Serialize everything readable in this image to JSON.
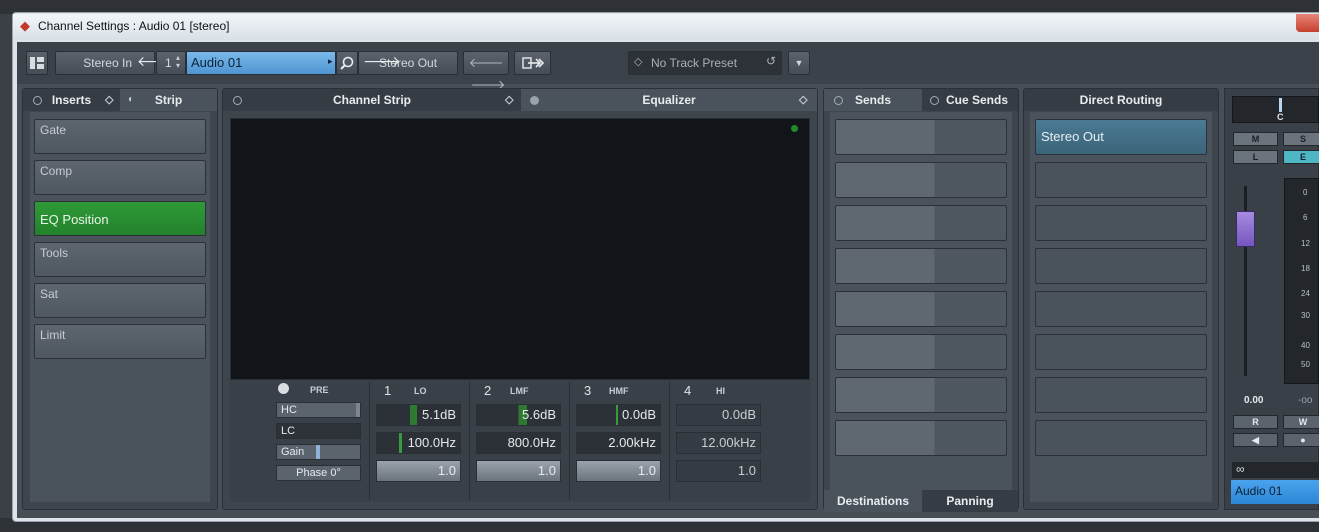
{
  "window": {
    "title": "Channel Settings : Audio 01 [stereo]"
  },
  "toolbar": {
    "input_label": "Stereo In",
    "channel_number": "1",
    "track_name": "Audio 01",
    "output_label": "Stereo Out",
    "preset_label": "No Track Preset"
  },
  "left_panel": {
    "tabs": [
      {
        "label": "Inserts"
      },
      {
        "label": "Strip"
      }
    ],
    "slots": [
      {
        "label": "Gate"
      },
      {
        "label": "Comp"
      },
      {
        "label": "EQ Position"
      },
      {
        "label": "Tools"
      },
      {
        "label": "Sat"
      },
      {
        "label": "Limit"
      }
    ]
  },
  "center_panel": {
    "tabs": [
      {
        "label": "Channel Strip"
      },
      {
        "label": "Equalizer"
      }
    ]
  },
  "eq": {
    "pre_label": "PRE",
    "hc_label": "HC",
    "lc_label": "LC",
    "gain_label": "Gain",
    "phase_label": "Phase 0°",
    "bands": [
      {
        "number": "1",
        "name": "LO",
        "gain": "5.1dB",
        "freq": "100.0Hz",
        "q": "1.0"
      },
      {
        "number": "2",
        "name": "LMF",
        "gain": "5.6dB",
        "freq": "800.0Hz",
        "q": "1.0"
      },
      {
        "number": "3",
        "name": "HMF",
        "gain": "0.0dB",
        "freq": "2.00kHz",
        "q": "1.0"
      },
      {
        "number": "4",
        "name": "HI",
        "gain": "0.0dB",
        "freq": "12.00kHz",
        "q": "1.0"
      }
    ]
  },
  "sends_panel": {
    "tabs": [
      {
        "label": "Sends"
      },
      {
        "label": "Cue Sends"
      }
    ],
    "bottom_tabs": [
      {
        "label": "Destinations"
      },
      {
        "label": "Panning"
      }
    ]
  },
  "routing_panel": {
    "title": "Direct Routing",
    "first_destination": "Stereo Out"
  },
  "fader_panel": {
    "pan_label": "C",
    "mute": "M",
    "solo": "S",
    "listen": "L",
    "edit": "E",
    "scale": [
      "0",
      "6",
      "12",
      "18",
      "24",
      "30",
      "40",
      "50"
    ],
    "volume_readout": "0.00",
    "peak_readout": "-oo",
    "read": "R",
    "write": "W",
    "channel_name": "Audio 01"
  },
  "colors": {
    "accent_blue": "#5a9fd8",
    "active_green": "#2a8f33",
    "fader_purple": "#8c6fd0",
    "route_teal": "#41708a"
  }
}
